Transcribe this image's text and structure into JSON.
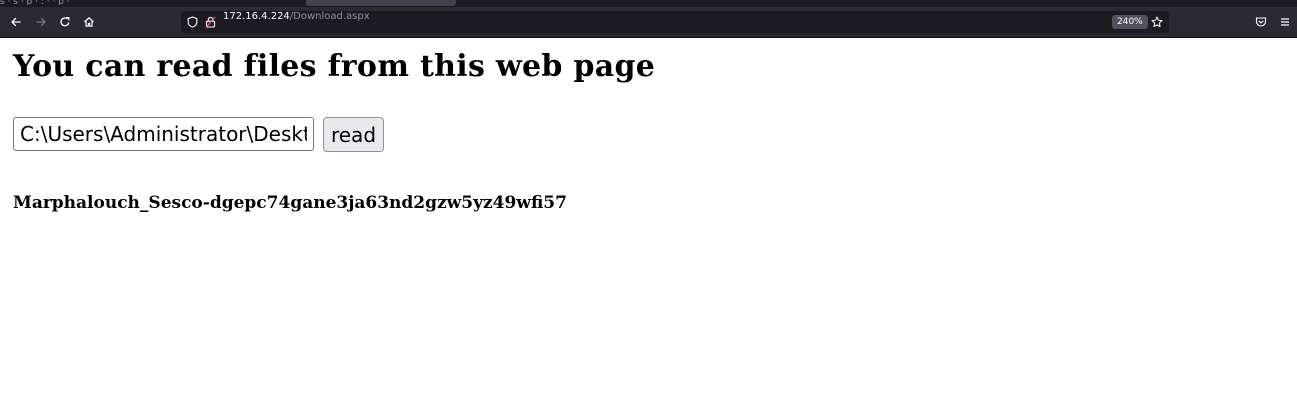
{
  "browser": {
    "tab_strip_text": "s  ·  s  ·  p   ·  :  ·  ·  p  ·",
    "url_host": "172.16.4.224",
    "url_path": "/Download.aspx",
    "zoom_level": "240%",
    "icons": {
      "back": "arrow-left-icon",
      "forward": "arrow-right-icon",
      "reload": "reload-icon",
      "home": "home-icon",
      "tracking": "shield-icon",
      "insecure": "lock-slash-icon",
      "bookmark": "star-icon",
      "pocket": "pocket-icon",
      "menu": "hamburger-menu-icon"
    },
    "colors": {
      "chrome_bg": "#2b2a33",
      "urlbar_bg": "#1c1b22",
      "text": "#fbfbfe"
    }
  },
  "page": {
    "title": "You can read files from this web page",
    "path_input_value": "C:\\Users\\Administrator\\Desktop\\",
    "read_button_label": "read",
    "file_contents": "Marphalouch_Sesco-dgepc74gane3ja63nd2gzw5yz49wfi57"
  }
}
